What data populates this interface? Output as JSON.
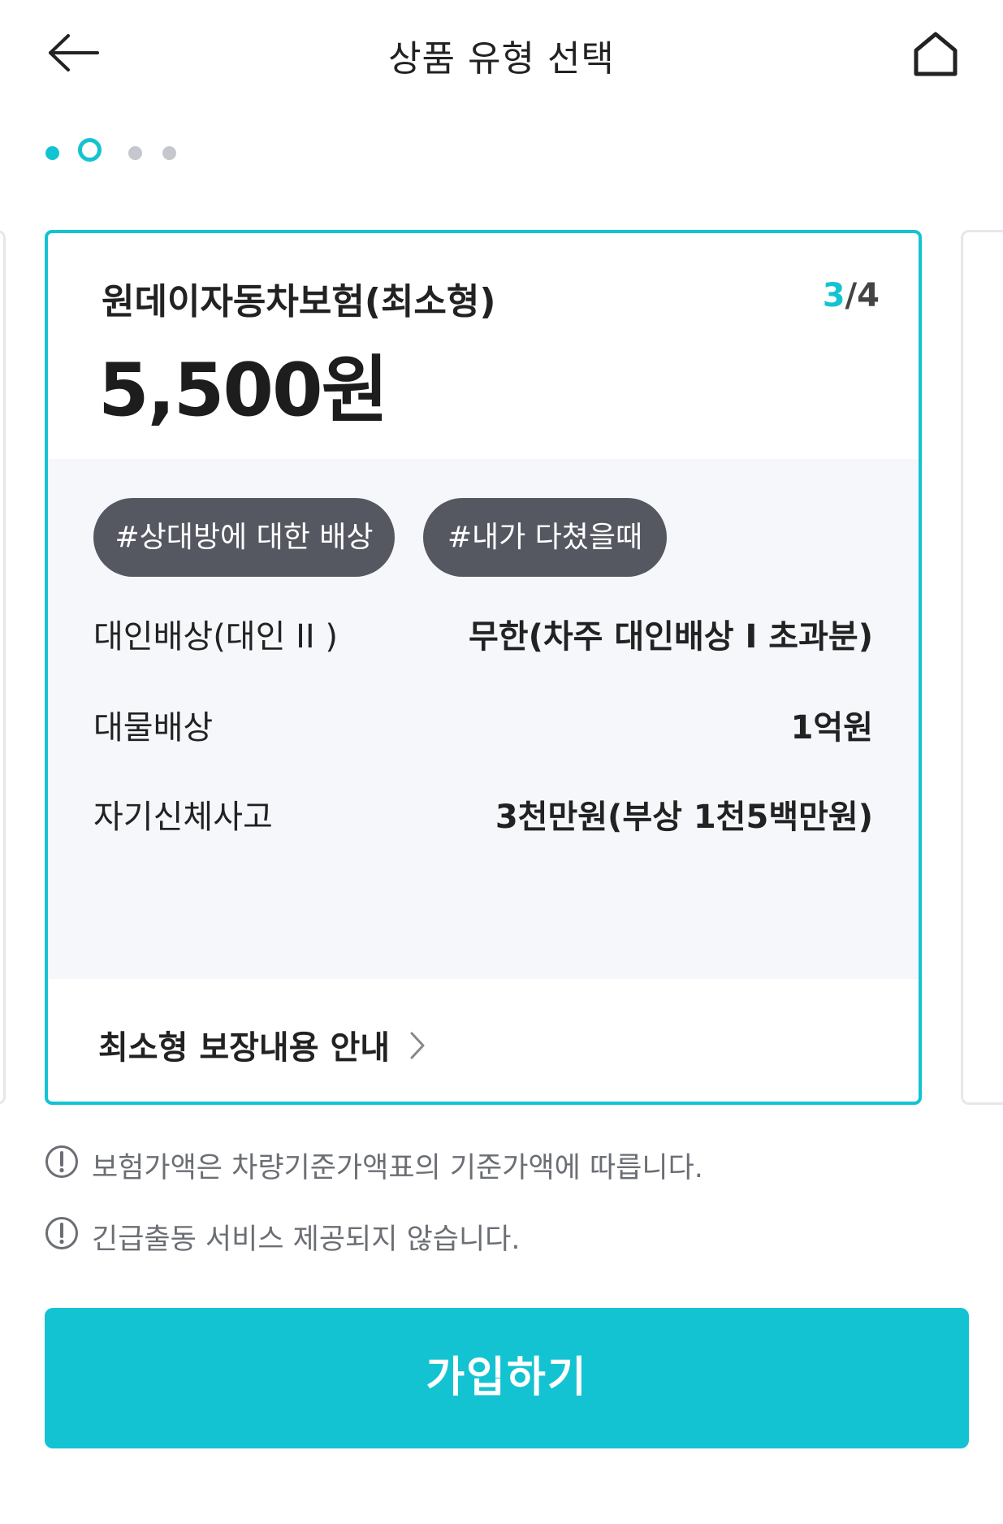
{
  "header": {
    "title": "상품 유형 선택",
    "back_icon": "arrow-left-icon",
    "home_icon": "home-icon"
  },
  "pager": {
    "total": 4,
    "active_index": 2
  },
  "card": {
    "product_name": "원데이자동차보험(최소형)",
    "page_current": "3",
    "page_separator": "/",
    "page_total": "4",
    "price": "5,500원",
    "tags": [
      "#상대방에 대한 배상",
      "#내가 다쳤을때"
    ],
    "coverage": [
      {
        "label": "대인배상(대인 II )",
        "value": "무한(차주 대인배상 I  초과분)"
      },
      {
        "label": "대물배상",
        "value": "1억원"
      },
      {
        "label": "자기신체사고",
        "value": "3천만원(부상 1천5백만원)"
      }
    ],
    "guide_link": "최소형 보장내용 안내"
  },
  "notices": [
    "보험가액은 차량기준가액표의 기준가액에 따릅니다.",
    "긴급출동 서비스 제공되지 않습니다."
  ],
  "cta_label": "가입하기",
  "colors": {
    "accent": "#14c3d2",
    "tag_bg": "#555861",
    "detail_bg": "#f5f7fb",
    "inactive_dot": "#c5c7cc"
  }
}
